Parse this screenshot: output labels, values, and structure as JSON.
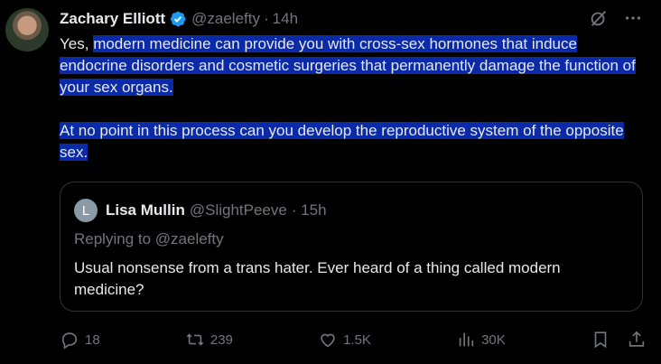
{
  "tweet": {
    "author_name": "Zachary Elliott",
    "handle": "@zaelefty",
    "separator": "·",
    "time": "14h",
    "text_prefix": "Yes, ",
    "text_highlight": "modern medicine can provide you with cross-sex hormones that induce endocrine disorders and cosmetic surgeries that permanently damage the function of your sex organs.",
    "paragraph2": "At no point in this process can you develop the reproductive system of the opposite sex."
  },
  "quote": {
    "avatar_letter": "L",
    "author_name": "Lisa Mullin",
    "handle": "@SlightPeeve",
    "time": "· 15h",
    "replying_to": "Replying to @zaelefty",
    "text": "Usual nonsense from a trans hater. Ever heard of a thing called modern medicine?"
  },
  "actions": {
    "replies": "18",
    "reposts": "239",
    "likes": "1.5K",
    "views": "30K"
  },
  "icons": [
    "verified-icon",
    "grok-icon",
    "more-icon",
    "reply-icon",
    "repost-icon",
    "like-icon",
    "views-icon",
    "bookmark-icon",
    "share-icon"
  ],
  "colors": {
    "background": "#000000",
    "text": "#e7e9ea",
    "muted": "#71767b",
    "highlight": "#0a2aa8",
    "verified": "#1d9bf0"
  }
}
